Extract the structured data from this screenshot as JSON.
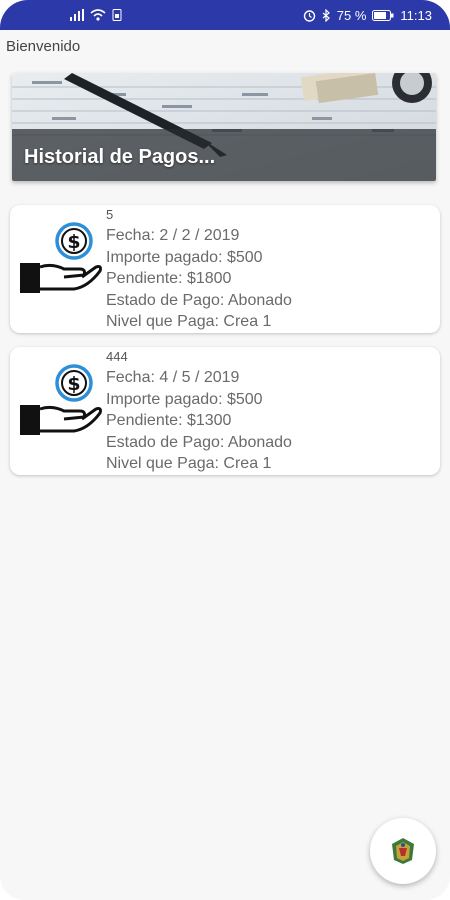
{
  "status_bar": {
    "battery": "75 %",
    "time": "11:13"
  },
  "greeting": "Bienvenido",
  "banner": {
    "title": "Historial de Pagos..."
  },
  "payments": [
    {
      "id": "5",
      "fecha": "Fecha: 2 / 2 / 2019",
      "importe": "Importe pagado: $500",
      "pendiente": "Pendiente: $1800",
      "estado": "Estado de Pago: Abonado",
      "nivel": "Nivel que Paga: Crea 1"
    },
    {
      "id": "444",
      "fecha": "Fecha: 4 / 5 / 2019",
      "importe": "Importe pagado: $500",
      "pendiente": "Pendiente: $1300",
      "estado": "Estado de Pago: Abonado",
      "nivel": "Nivel que Paga: Crea 1"
    }
  ],
  "icons": {
    "payment": "hand-dollar-icon",
    "fab": "logo-icon"
  },
  "colors": {
    "status_bar": "#2b3aa8",
    "coin_ring": "#2d8fd8"
  }
}
